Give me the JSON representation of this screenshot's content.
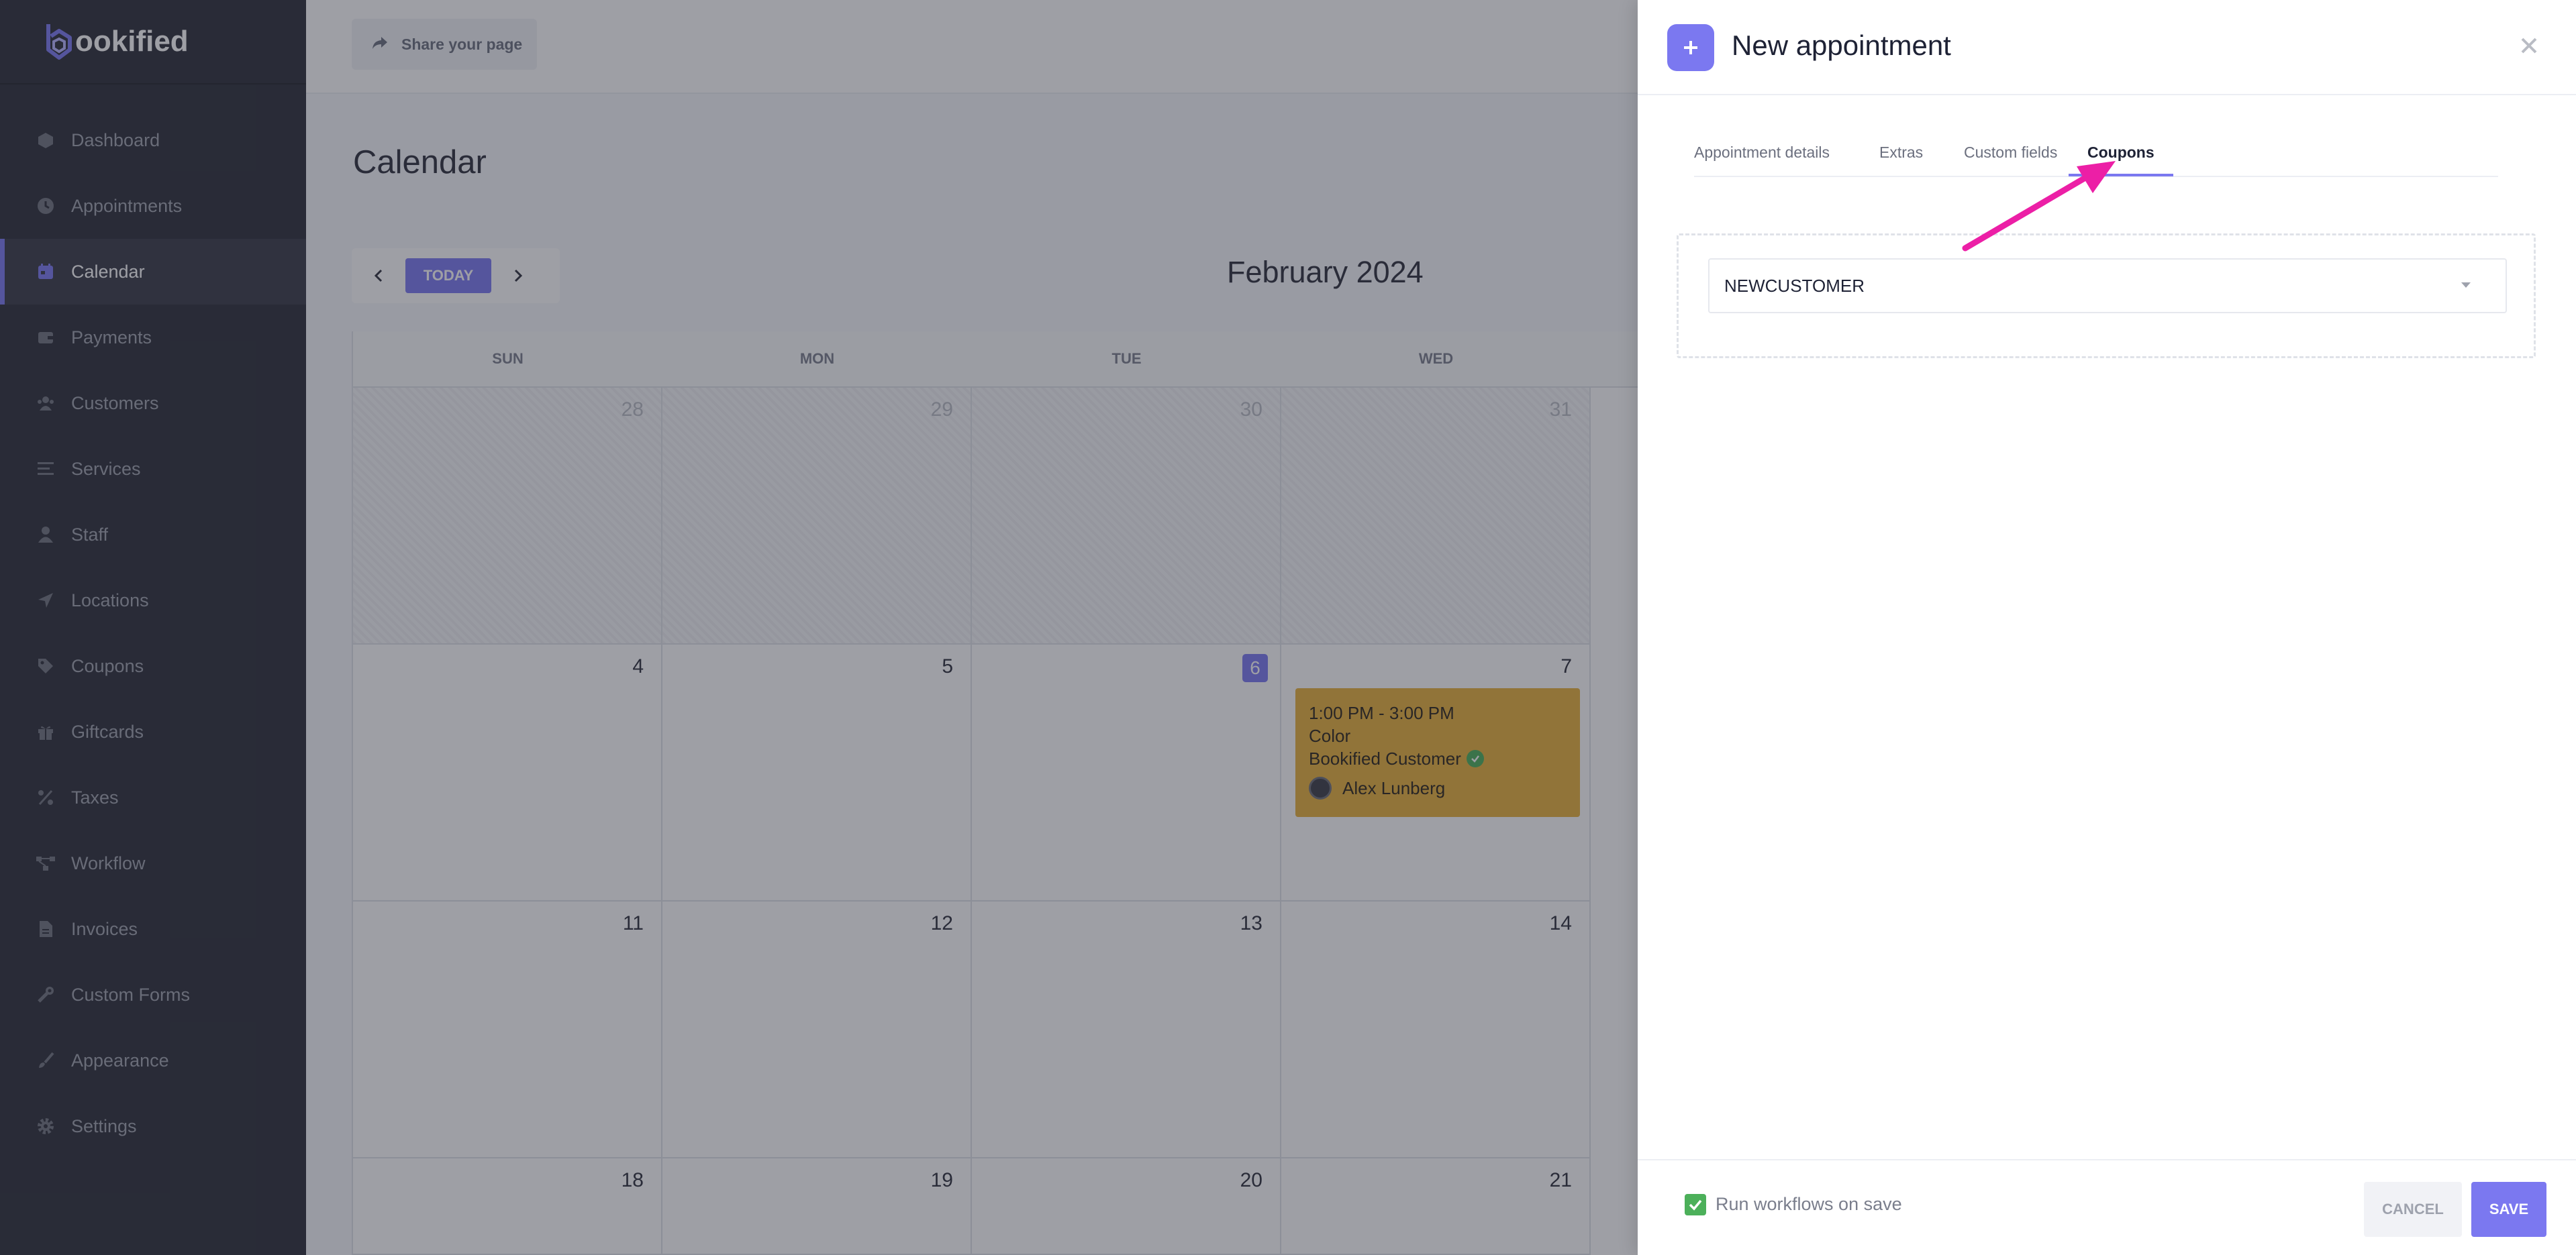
{
  "app": {
    "logo_text": "ookified"
  },
  "sidebar": {
    "items": [
      {
        "label": "Dashboard",
        "icon": "cube-icon"
      },
      {
        "label": "Appointments",
        "icon": "clock-icon"
      },
      {
        "label": "Calendar",
        "icon": "calendar-icon",
        "active": true
      },
      {
        "label": "Payments",
        "icon": "wallet-icon"
      },
      {
        "label": "Customers",
        "icon": "users-icon"
      },
      {
        "label": "Services",
        "icon": "list-icon"
      },
      {
        "label": "Staff",
        "icon": "user-icon"
      },
      {
        "label": "Locations",
        "icon": "location-arrow-icon"
      },
      {
        "label": "Coupons",
        "icon": "tag-icon"
      },
      {
        "label": "Giftcards",
        "icon": "gift-icon"
      },
      {
        "label": "Taxes",
        "icon": "percent-icon"
      },
      {
        "label": "Workflow",
        "icon": "workflow-icon"
      },
      {
        "label": "Invoices",
        "icon": "file-icon"
      },
      {
        "label": "Custom Forms",
        "icon": "tools-icon"
      },
      {
        "label": "Appearance",
        "icon": "brush-icon"
      },
      {
        "label": "Settings",
        "icon": "gear-icon"
      }
    ]
  },
  "topbar": {
    "share_label": "Share your page"
  },
  "main": {
    "title": "Calendar"
  },
  "calendar": {
    "today_label": "TODAY",
    "month": "February 2024",
    "weekdays": [
      "SUN",
      "MON",
      "TUE",
      "WED"
    ],
    "weeks": [
      [
        "28",
        "29",
        "30",
        "31"
      ],
      [
        "4",
        "5",
        "6",
        "7"
      ],
      [
        "11",
        "12",
        "13",
        "14"
      ],
      [
        "18",
        "19",
        "20",
        "21"
      ]
    ],
    "event": {
      "time": "1:00 PM - 3:00 PM",
      "service": "Color",
      "customer": "Bookified Customer",
      "staff": "Alex Lunberg",
      "color": "#e8b13b"
    }
  },
  "drawer": {
    "title": "New appointment",
    "tabs": [
      "Appointment details",
      "Extras",
      "Custom fields",
      "Coupons"
    ],
    "active_tab": "Coupons",
    "coupon_value": "NEWCUSTOMER",
    "footer": {
      "run_workflows_label": "Run workflows on save",
      "run_workflows_checked": true,
      "cancel_label": "CANCEL",
      "save_label": "SAVE"
    }
  },
  "colors": {
    "accent": "#7b78f0",
    "sidebar_bg": "#2a2d37",
    "annotation_arrow": "#ec1fa6",
    "success": "#4cb05a"
  }
}
